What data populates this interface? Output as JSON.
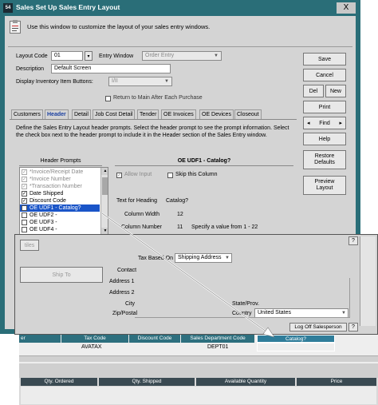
{
  "window": {
    "title": "Sales Set Up Sales Entry Layout",
    "close_label": "X",
    "app_icon_label": "54"
  },
  "intro": "Use this window to customize the layout of your sales entry windows.",
  "form": {
    "layout_code_label": "Layout Code",
    "layout_code_value": "01",
    "entry_window_label": "Entry Window",
    "entry_window_value": "Order Entry",
    "description_label": "Description",
    "description_value": "Default Screen",
    "display_inv_label": "Display Inventory Item Buttons:",
    "display_inv_value": "I/II",
    "return_main_label": "Return to Main After Each Purchase"
  },
  "side_buttons": {
    "save": "Save",
    "cancel": "Cancel",
    "del": "Del",
    "new": "New",
    "print": "Print",
    "find": "Find",
    "help": "Help",
    "restore_defaults": "Restore Defaults",
    "preview_layout": "Preview Layout"
  },
  "tabs": [
    "Customers",
    "Header",
    "Detail",
    "Job Cost Detail",
    "Tender",
    "OE Invoices",
    "OE Devices",
    "Closeout"
  ],
  "instructions": "Define the Sales Entry Layout header prompts. Select the header prompt to see the prompt information. Select the check box next to the header prompt to include it in the Header section of the Sales Entry window.",
  "header_prompts": {
    "title": "Header Prompts",
    "items": [
      {
        "label": "*Invoice/Receipt Date",
        "checked": "✓",
        "dim": true
      },
      {
        "label": "*Invoice Number",
        "checked": "✓",
        "dim": true
      },
      {
        "label": "*Transaction Number",
        "checked": "✓",
        "dim": true
      },
      {
        "label": "Date Shipped",
        "checked": "✓",
        "dim": false
      },
      {
        "label": "Discount Code",
        "checked": "✓",
        "dim": false
      },
      {
        "label": "OE UDF1 - Catalog?",
        "checked": "✓",
        "dim": false
      },
      {
        "label": "OE UDF2 -",
        "checked": "",
        "dim": false
      },
      {
        "label": "OE UDF3 -",
        "checked": "",
        "dim": false
      },
      {
        "label": "OE UDF4 -",
        "checked": "",
        "dim": false
      }
    ]
  },
  "detail_panel": {
    "title": "OE UDF1 - Catalog?",
    "allow_input_label": "Allow Input",
    "skip_column_label": "Skip this Column",
    "text_heading_label": "Text for Heading",
    "text_heading_value": "Catalog?",
    "column_width_label": "Column Width",
    "column_width_value": "12",
    "column_number_label": "Column Number",
    "column_number_value": "11",
    "range_hint": "Specify a value from 1 - 22"
  },
  "preview": {
    "question_mark": "?",
    "tax_based_on_label": "Tax Based On",
    "tax_based_on_value": "Shipping Address",
    "contact_label": "Contact",
    "address1_label": "Address 1",
    "address2_label": "Address 2",
    "city_label": "City",
    "state_label": "State/Prov.",
    "zip_label": "Zip/Postal",
    "country_label": "Country",
    "country_value": "United States",
    "ship_to_label": "Ship To",
    "tiles_label": "tiles",
    "logoff_label": "Log Off Salesperson",
    "grid_headers": [
      "er",
      "Tax Code",
      "Discount Code",
      "Sales Department Code",
      "Catalog?"
    ],
    "grid_values": [
      "",
      "AVATAX",
      "",
      "DEPT01",
      ""
    ],
    "detail_headers": [
      "Qty. Ordered",
      "Qty. Shipped",
      "Available Quantity",
      "Price"
    ]
  },
  "colors": {
    "title_bar": "#2a6e78",
    "selection": "#1a55c8",
    "grid_header": "#2d6f7e",
    "arrow": "#ffffff"
  }
}
